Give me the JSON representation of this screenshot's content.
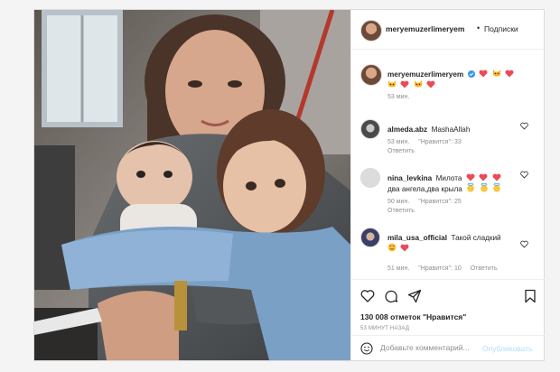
{
  "post": {
    "photo_alt": "",
    "author": "meryemuzerlimeryem",
    "follow_label": "Подписки",
    "caption": {
      "user": "meryemuzerlimeryem",
      "emojis": [
        "heart",
        "cat-face",
        "heart",
        "cat-face",
        "heart",
        "cat-face",
        "heart"
      ],
      "time": "53 мин."
    },
    "comments": [
      {
        "user": "almeda.abz",
        "text": "MashaAllah",
        "time": "53 мин.",
        "likes": "\"Нравится\": 33",
        "reply": "Ответить"
      },
      {
        "user": "nina_levkina",
        "text": "Милота",
        "text2": "два ангела,два крыла",
        "time": "50 мин.",
        "likes": "\"Нравится\": 25",
        "reply": "Ответить"
      },
      {
        "user": "mila_usa_official",
        "text": "Такой сладкий",
        "time": "51 мин.",
        "likes": "\"Нравится\": 10",
        "reply": "Ответить"
      }
    ],
    "likes_text": "130 008 отметок \"Нравится\"",
    "posted_ago": "53 МИНУТ НАЗАД",
    "comment_placeholder": "Добавьте комментарий...",
    "publish_label": "Опубликовать"
  },
  "colors": {
    "heart_red": "#ed4956",
    "verified_blue": "#3897f0",
    "publish_disabled": "#b2dffc"
  }
}
